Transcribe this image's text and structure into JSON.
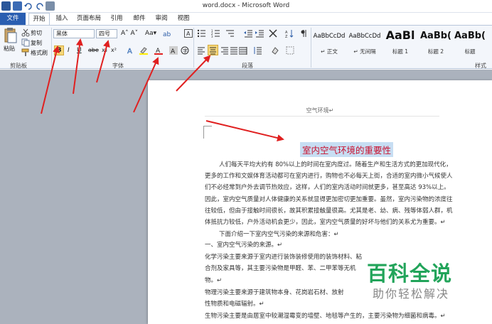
{
  "window": {
    "title": "word.docx - Microsoft Word"
  },
  "tabs": [
    "文件",
    "开始",
    "插入",
    "页面布局",
    "引用",
    "邮件",
    "审阅",
    "视图"
  ],
  "ribbon": {
    "clipboard": {
      "paste": "粘贴",
      "cut": "剪切",
      "copy": "复制",
      "format_painter": "格式刷",
      "label": "剪贴板"
    },
    "font": {
      "name": "黑体",
      "size": "四号",
      "bold": "B",
      "italic": "I",
      "underline": "U",
      "label": "字体"
    },
    "paragraph": {
      "label": "段落"
    },
    "styles": {
      "items": [
        {
          "sample": "AaBbCcDd",
          "name": "↵ 正文"
        },
        {
          "sample": "AaBbCcDd",
          "name": "↵ 无间隔"
        },
        {
          "sample": "AaBl",
          "name": "标题 1"
        },
        {
          "sample": "AaBb(",
          "name": "标题 2"
        },
        {
          "sample": "AaBb(",
          "name": "标题"
        }
      ],
      "label": "样式"
    }
  },
  "document": {
    "header": "空气环境↵",
    "title": "室内空气环境的重要性",
    "lines": [
      "人们每天平均大约有 80%以上的时间在室内度过。随着生产和生活方式的更加现代化，",
      "更多的工作和文娱体育活动都可在室内进行，购物也不必每天上街，合适的室内微小气候使人",
      "们不必经常到户外去调节热效应，这样，人们的室内活动时间就更多，甚至高达 93%以上。",
      "因此，室内空气质量对人体健康的关系就显得更加密切更加重要。虽然，室内污染物的浓度往",
      "往较低，但由于接触时间很长，故其积累接触量很高。尤其是老、幼、病、残等体弱人群，机",
      "体抵抗力较低，户外活动机会更少，因此，室内空气质量的好坏与他们的关系尤为重要。↵",
      "下面介绍一下室内空气污染的来源和危害：↵",
      "一、室内空气污染的来源。↵",
      "化学污染主要来源于室内进行装饰装修使用的装饰材料、粘",
      "合剂及家具等，其主要污染物是甲醛、苯、二甲苯等无机",
      "物。↵",
      "物理污染主要来源于建筑物本身、花岗岩石材、放射",
      "性物质和电磁辐射。↵",
      "生物污染主要是由居室中较潮湿霉变的墙壁、地毯等产生的，主要污染物为细菌和病毒。↵"
    ]
  },
  "watermark": {
    "title": "百科全说",
    "subtitle": "助你轻松解决"
  },
  "colors": {
    "accent": "#2a5eb1",
    "highlight": "#c7def3",
    "title_red": "#c8102e",
    "arrow": "#e02020",
    "watermark": "#22a45a"
  }
}
